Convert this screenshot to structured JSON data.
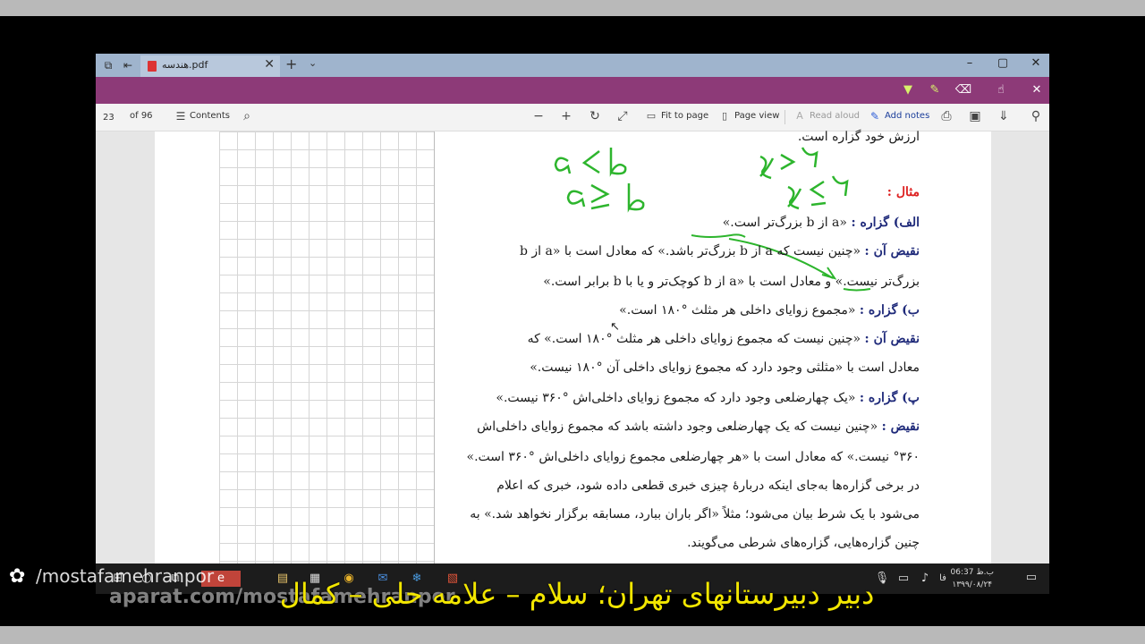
{
  "browser": {
    "tab_title": "هندسه.pdf",
    "tab_close": "✕",
    "new_tab": "+",
    "tab_dropdown": "⌄",
    "window_controls": [
      "–",
      "▢",
      "✕"
    ]
  },
  "toolbar": {
    "page_current": "23",
    "page_total": "of 96",
    "contents_label": "Contents",
    "fit_to_page_label": "Fit to page",
    "page_view_label": "Page view",
    "read_aloud_label": "Read aloud",
    "add_notes_label": "Add notes"
  },
  "document": {
    "lines": {
      "l0": "ارزش خود گزاره است.",
      "l1_label": "مثال :",
      "l2_label": "الف) گزاره :",
      "l2_text": "«a از b بزرگ‌تر است.»",
      "l3_label": "نقیض آن :",
      "l3_text": "«چنین نیست که a از b بزرگ‌تر باشد.» که معادل است با «a از b",
      "l4_text": "بزرگ‌تر نیست.» و معادل است با «a از b کوچک‌تر و یا با b برابر است.»",
      "l5_label": "ب) گزاره :",
      "l5_text": "«مجموع زوایای داخلی هر مثلث °۱۸۰ است.»",
      "l6_label": "نقیض آن :",
      "l6_text": "«چنین نیست که مجموع زوایای داخلی هر مثلث °۱۸۰ است.» که",
      "l7_text": "معادل است با «مثلثی وجود دارد که مجموع زوایای داخلی آن °۱۸۰ نیست.»",
      "l8_label": "پ) گزاره :",
      "l8_text": "«یک چهارضلعی وجود دارد که مجموع زوایای داخلی‌اش °۳۶۰ نیست.»",
      "l9_label": "نقیض :",
      "l9_text": "«چنین نیست که یک چهارضلعی وجود داشته باشد که مجموع زوایای داخلی‌اش",
      "l10_text": "°۳۶۰ نیست.» که معادل است با «هر چهارضلعی مجموع زوایای داخلی‌اش °۳۶۰ است.»",
      "l11_text": "در برخی گزاره‌ها به‌جای اینکه دربارهٔ چیزی خبری قطعی داده شود، خبری که اعلام",
      "l12_text": "می‌شود با یک شرط بیان می‌شود؛ مثلاً «اگر باران ببارد، مسابقه برگزار نخواهد شد.» به",
      "l13_text": "چنین گزاره‌هایی، گزاره‌های شرطی می‌گویند."
    }
  },
  "handwriting": {
    "h1": "a<b",
    "h2": "a≥b",
    "h3": "x>۲",
    "h4": "x≤۲",
    "color": "#2db52d"
  },
  "taskbar": {
    "time": "06:37 ب.ظ",
    "date": "۱۳۹۹/۰۸/۲۴",
    "lang": "فا"
  },
  "overlay": {
    "watermark_handle": "/mostafamehranpor",
    "watermark_site": "aparat.com/mostafamehranpor",
    "caption": "دبیر دبیرستانهای تهران؛ سلام – علامه حلی – کمال"
  }
}
